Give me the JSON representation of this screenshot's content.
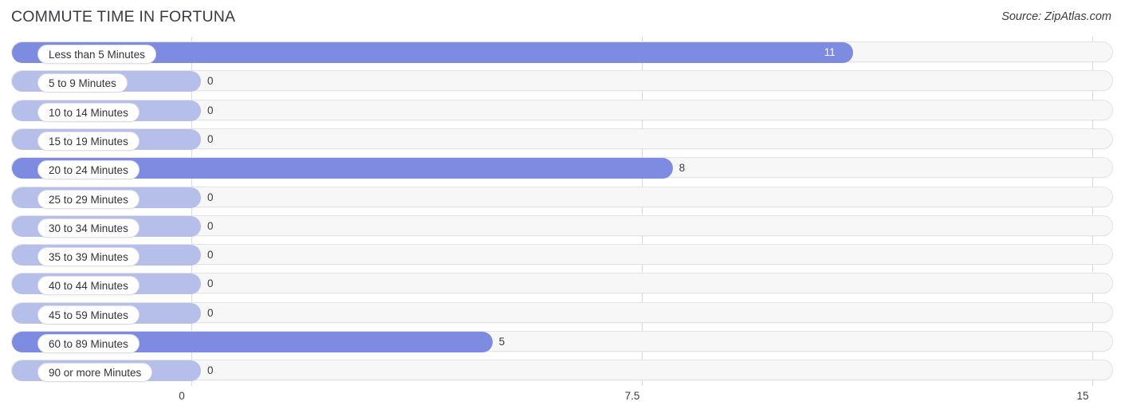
{
  "header": {
    "title": "COMMUTE TIME IN FORTUNA",
    "source": "Source: ZipAtlas.com"
  },
  "colors": {
    "bar_strong": "#7d8ce0",
    "bar_weak": "#b6bfe9",
    "track_background": "#f7f7f7",
    "gridline": "#d8d8de",
    "label_chip_background": "#ffffff",
    "text": "#33333a"
  },
  "chart_data": {
    "type": "bar",
    "orientation": "horizontal",
    "title": "COMMUTE TIME IN FORTUNA",
    "xlabel": "",
    "ylabel": "",
    "xlim": [
      0,
      15
    ],
    "grid": true,
    "legend": "none",
    "x_ticks": [
      "0",
      "7.5",
      "15"
    ],
    "x_tick_values": [
      0,
      7.5,
      15
    ],
    "categories": [
      "Less than 5 Minutes",
      "5 to 9 Minutes",
      "10 to 14 Minutes",
      "15 to 19 Minutes",
      "20 to 24 Minutes",
      "25 to 29 Minutes",
      "30 to 34 Minutes",
      "35 to 39 Minutes",
      "40 to 44 Minutes",
      "45 to 59 Minutes",
      "60 to 89 Minutes",
      "90 or more Minutes"
    ],
    "values": [
      11,
      0,
      0,
      0,
      8,
      0,
      0,
      0,
      0,
      0,
      5,
      0
    ],
    "value_labels": [
      "11",
      "0",
      "0",
      "0",
      "8",
      "0",
      "0",
      "0",
      "0",
      "0",
      "5",
      "0"
    ]
  },
  "rows": [
    {
      "label": "Less than 5 Minutes",
      "value": 11,
      "value_label": "11"
    },
    {
      "label": "5 to 9 Minutes",
      "value": 0,
      "value_label": "0"
    },
    {
      "label": "10 to 14 Minutes",
      "value": 0,
      "value_label": "0"
    },
    {
      "label": "15 to 19 Minutes",
      "value": 0,
      "value_label": "0"
    },
    {
      "label": "20 to 24 Minutes",
      "value": 8,
      "value_label": "8"
    },
    {
      "label": "25 to 29 Minutes",
      "value": 0,
      "value_label": "0"
    },
    {
      "label": "30 to 34 Minutes",
      "value": 0,
      "value_label": "0"
    },
    {
      "label": "35 to 39 Minutes",
      "value": 0,
      "value_label": "0"
    },
    {
      "label": "40 to 44 Minutes",
      "value": 0,
      "value_label": "0"
    },
    {
      "label": "45 to 59 Minutes",
      "value": 0,
      "value_label": "0"
    },
    {
      "label": "60 to 89 Minutes",
      "value": 5,
      "value_label": "5"
    },
    {
      "label": "90 or more Minutes",
      "value": 0,
      "value_label": "0"
    }
  ]
}
